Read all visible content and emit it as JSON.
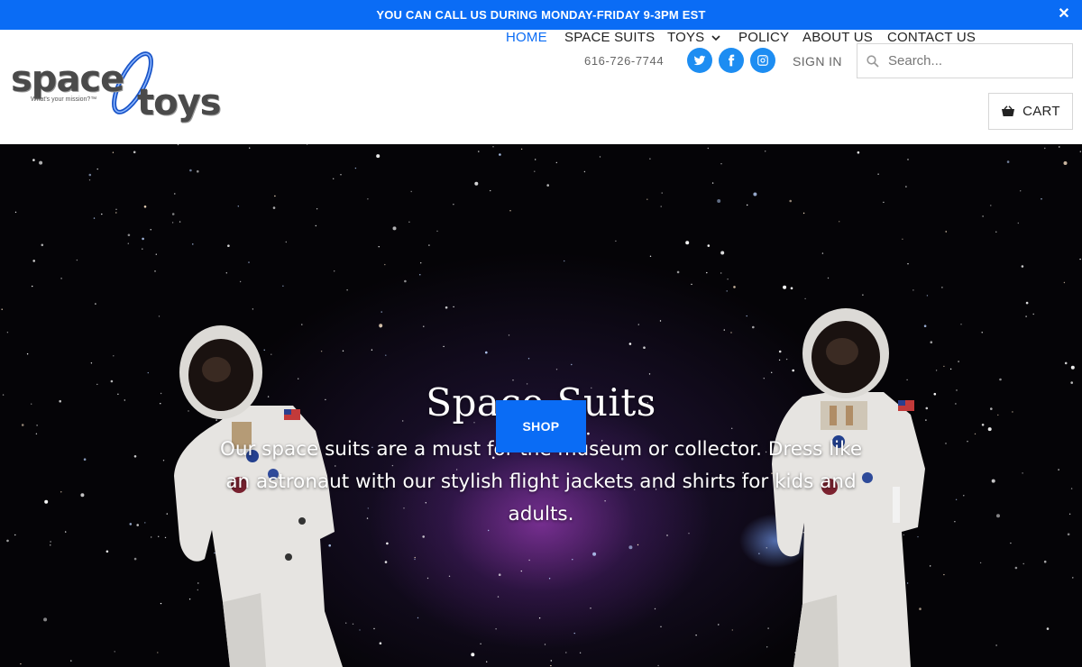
{
  "announcement": {
    "text": "YOU CAN CALL US DURING MONDAY-FRIDAY 9-3PM EST",
    "close_symbol": "✕"
  },
  "logo": {
    "word1": "space",
    "word2": "toys",
    "tagline": "What's your mission?™"
  },
  "header": {
    "phone": "616-726-7744",
    "social": [
      "twitter-icon",
      "facebook-icon",
      "instagram-icon"
    ],
    "signin_label": "SIGN IN",
    "search_placeholder": "Search...",
    "cart_label": "CART"
  },
  "nav": {
    "items": [
      {
        "label": "HOME",
        "active": true
      },
      {
        "label": "SPACE SUITS",
        "active": false
      },
      {
        "label": "TOYS",
        "active": false,
        "has_dropdown": true
      },
      {
        "label": "POLICY",
        "active": false
      },
      {
        "label": "ABOUT US",
        "active": false
      },
      {
        "label": "CONTACT US",
        "active": false
      }
    ]
  },
  "hero": {
    "title": "Space Suits",
    "text": "Our space suits are a must for the museum or collector. Dress like an astronaut with our stylish flight jackets and shirts for kids and adults.",
    "button_label": "SHOP"
  },
  "colors": {
    "accent": "#0a6cf5",
    "social": "#1d8df2",
    "hero_bg": "#050407"
  }
}
